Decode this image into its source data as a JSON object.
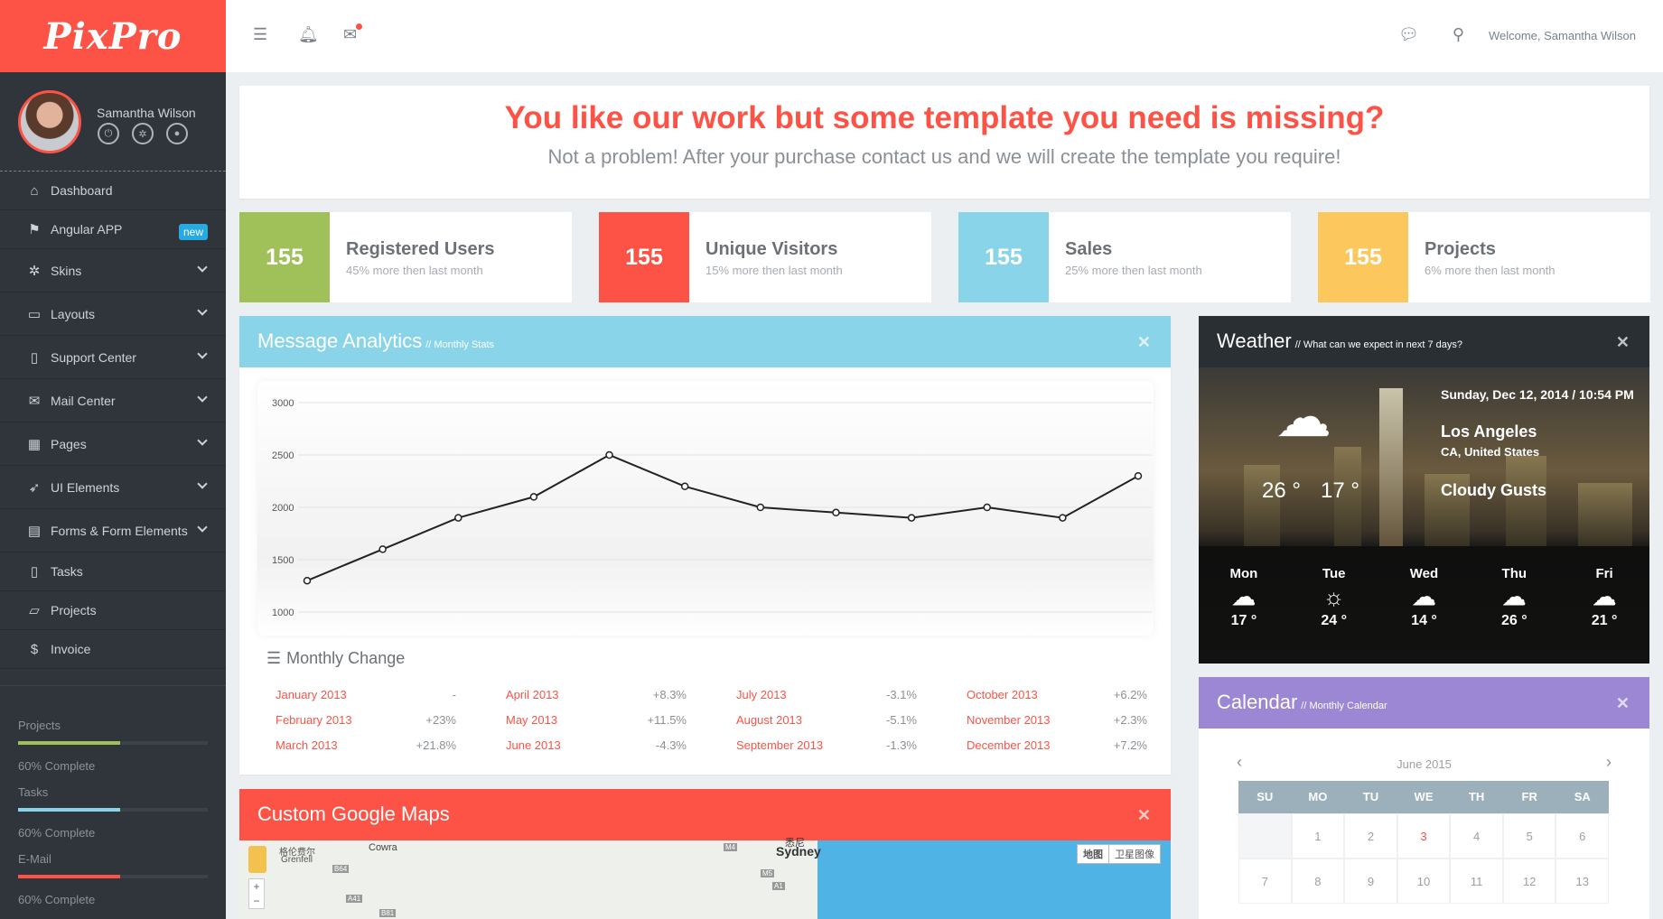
{
  "brand": {
    "logo": "PixPro"
  },
  "user": {
    "name": "Samantha Wilson",
    "welcome": "Welcome, Samantha Wilson"
  },
  "profile_icons": [
    "power-icon",
    "gear-icon",
    "chat-icon"
  ],
  "nav": [
    {
      "label": "Dashboard",
      "icon": "home-icon",
      "glyph": "⌂",
      "chevron": false
    },
    {
      "label": "Angular APP",
      "icon": "flag-icon",
      "glyph": "⚑",
      "chevron": false,
      "badge": "new"
    },
    {
      "label": "Skins",
      "icon": "gear-icon",
      "glyph": "✲",
      "chevron": true
    },
    {
      "label": "Layouts",
      "icon": "monitor-icon",
      "glyph": "▭",
      "chevron": true
    },
    {
      "label": "Support Center",
      "icon": "mobile-icon",
      "glyph": "▯",
      "chevron": true
    },
    {
      "label": "Mail Center",
      "icon": "envelope-icon",
      "glyph": "✉",
      "chevron": true
    },
    {
      "label": "Pages",
      "icon": "windows-icon",
      "glyph": "▦",
      "chevron": true
    },
    {
      "label": "UI Elements",
      "icon": "rocket-icon",
      "glyph": "➶",
      "chevron": true
    },
    {
      "label": "Forms & Form Elements",
      "icon": "book-icon",
      "glyph": "▤",
      "chevron": true
    },
    {
      "label": "Tasks",
      "icon": "file-icon",
      "glyph": "▯",
      "chevron": false
    },
    {
      "label": "Projects",
      "icon": "folder-icon",
      "glyph": "▱",
      "chevron": false
    },
    {
      "label": "Invoice",
      "icon": "dollar-icon",
      "glyph": "$",
      "chevron": false
    }
  ],
  "progress": [
    {
      "label": "Projects",
      "complete": "60% Complete",
      "value": 0.6,
      "color": "#a0c05a"
    },
    {
      "label": "Tasks",
      "complete": "60% Complete",
      "value": 0.6,
      "color": "#8ad4ea"
    },
    {
      "label": "E-Mail",
      "complete": "60% Complete",
      "value": 0.6,
      "color": "#fc5346"
    }
  ],
  "banner": {
    "title": "You like our work but some template you need is missing?",
    "subtitle": "Not a problem! After your purchase contact us and we will create the template you require!"
  },
  "stats": [
    {
      "value": "155",
      "title": "Registered Users",
      "sub": "45% more then last month",
      "color": "#a0c05a"
    },
    {
      "value": "155",
      "title": "Unique Visitors",
      "sub": "15% more then last month",
      "color": "#fc5346"
    },
    {
      "value": "155",
      "title": "Sales",
      "sub": "25% more then last month",
      "color": "#8ad4ea"
    },
    {
      "value": "155",
      "title": "Projects",
      "sub": "6% more then last month",
      "color": "#fcc75c"
    }
  ],
  "analytics": {
    "title": "Message Analytics",
    "subtitle": "// Monthly Stats",
    "monthly_change_title": "Monthly Change",
    "changes": [
      {
        "month": "January 2013",
        "change": "-"
      },
      {
        "month": "February 2013",
        "change": "+23%"
      },
      {
        "month": "March 2013",
        "change": "+21.8%"
      },
      {
        "month": "April 2013",
        "change": "+8.3%"
      },
      {
        "month": "May 2013",
        "change": "+11.5%"
      },
      {
        "month": "June 2013",
        "change": "-4.3%"
      },
      {
        "month": "July 2013",
        "change": "-3.1%"
      },
      {
        "month": "August 2013",
        "change": "-5.1%"
      },
      {
        "month": "September 2013",
        "change": "-1.3%"
      },
      {
        "month": "October 2013",
        "change": "+6.2%"
      },
      {
        "month": "November 2013",
        "change": "+2.3%"
      },
      {
        "month": "December 2013",
        "change": "+7.2%"
      }
    ]
  },
  "chart_data": {
    "type": "line",
    "title": "",
    "xlabel": "",
    "ylabel": "",
    "ylim": [
      1000,
      3000
    ],
    "yticks": [
      "3000",
      "2500",
      "2000",
      "1500",
      "1000"
    ],
    "x": [
      1,
      2,
      3,
      4,
      5,
      6,
      7,
      8,
      9,
      10,
      11,
      12
    ],
    "series": [
      {
        "values": [
          1300,
          1600,
          1900,
          2100,
          2500,
          2200,
          2000,
          1950,
          1900,
          2000,
          1900,
          2300
        ]
      }
    ],
    "grid": true,
    "color": "#222222"
  },
  "weather": {
    "title": "Weather",
    "subtitle": "// What can we expect in next 7 days?",
    "datetime": "Sunday, Dec 12, 2014 / 10:54 PM",
    "city": "Los Angeles",
    "region": "CA, United States",
    "high": "26 °",
    "low": "17 °",
    "condition": "Cloudy Gusts",
    "forecast": [
      {
        "day": "Mon",
        "temp": "17 °",
        "icon": "windy-cloud-icon"
      },
      {
        "day": "Tue",
        "temp": "24 °",
        "icon": "sun-icon"
      },
      {
        "day": "Wed",
        "temp": "14 °",
        "icon": "windy-cloud-icon"
      },
      {
        "day": "Thu",
        "temp": "26 °",
        "icon": "night-cloud-icon"
      },
      {
        "day": "Fri",
        "temp": "21 °",
        "icon": "night-cloud-icon"
      }
    ]
  },
  "calendar": {
    "title": "Calendar",
    "subtitle": "// Monthly Calendar",
    "month": "June 2015",
    "weekdays": [
      "SU",
      "MO",
      "TU",
      "WE",
      "TH",
      "FR",
      "SA"
    ],
    "weeks": [
      [
        "",
        "1",
        "2",
        "3",
        "4",
        "5",
        "6"
      ],
      [
        "7",
        "8",
        "9",
        "10",
        "11",
        "12",
        "13"
      ]
    ],
    "today": "3"
  },
  "maps": {
    "title": "Custom Google Maps",
    "map_button": "地图",
    "satellite_button": "卫星图像",
    "labels": [
      "格伦费尔",
      "Grenfell",
      "Cowra",
      "Sydney",
      "悉尼",
      "B64",
      "A41",
      "B81",
      "M4",
      "M5",
      "A1"
    ]
  },
  "colors": {
    "accent": "#fc5346",
    "sidebar": "#2f353b",
    "analytics_head": "#8ad4ea",
    "calendar_head": "#9b87d4",
    "weather_head": "#2a2f34"
  }
}
